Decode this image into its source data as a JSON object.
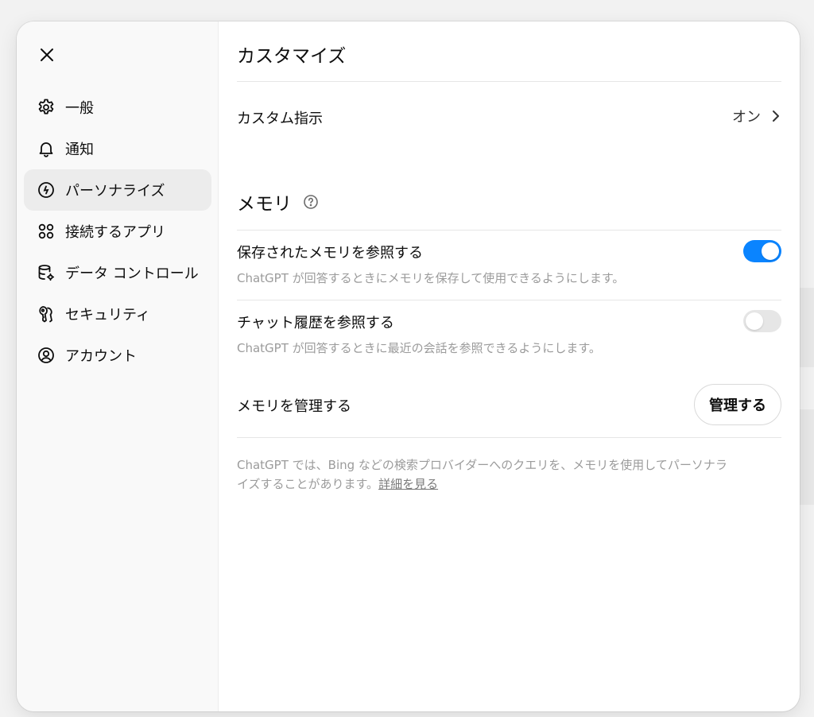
{
  "sidebar": {
    "items": [
      {
        "label": "一般",
        "icon": "gear-icon",
        "active": false
      },
      {
        "label": "通知",
        "icon": "bell-icon",
        "active": false
      },
      {
        "label": "パーソナライズ",
        "icon": "personalize-icon",
        "active": true
      },
      {
        "label": "接続するアプリ",
        "icon": "apps-icon",
        "active": false
      },
      {
        "label": "データ コントロール",
        "icon": "database-gear-icon",
        "active": false
      },
      {
        "label": "セキュリティ",
        "icon": "shield-key-icon",
        "active": false
      },
      {
        "label": "アカウント",
        "icon": "user-circle-icon",
        "active": false
      }
    ]
  },
  "main": {
    "title": "カスタマイズ",
    "custom_instructions": {
      "label": "カスタム指示",
      "value": "オン"
    },
    "memory": {
      "title": "メモリ",
      "reference_saved": {
        "label": "保存されたメモリを参照する",
        "description": "ChatGPT が回答するときにメモリを保存して使用できるようにします。",
        "enabled": true
      },
      "reference_history": {
        "label": "チャット履歴を参照する",
        "description": "ChatGPT が回答するときに最近の会話を参照できるようにします。",
        "enabled": false
      },
      "manage": {
        "label": "メモリを管理する",
        "button": "管理する"
      }
    },
    "footnote": {
      "text": "ChatGPT では、Bing などの検索プロバイダーへのクエリを、メモリを使用してパーソナライズすることがあります。",
      "link": "詳細を見る"
    }
  },
  "colors": {
    "toggle_on": "#0a84ff",
    "toggle_off": "#e6e6e6",
    "active_nav_bg": "#ececec"
  }
}
